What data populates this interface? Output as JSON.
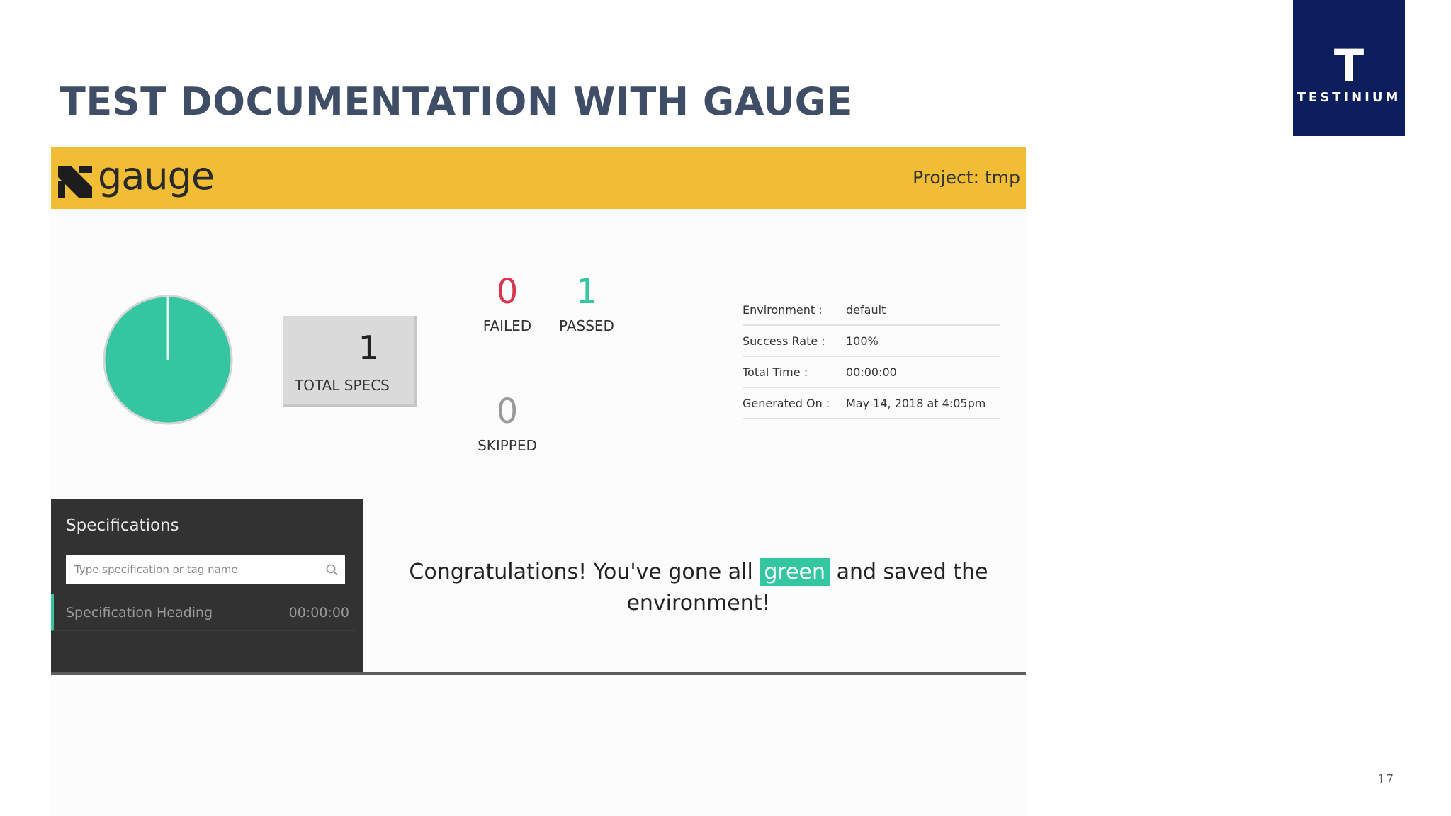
{
  "slide": {
    "title": "TEST DOCUMENTATION WITH GAUGE",
    "brand_letter": "T",
    "brand_name": "TESTINIUM",
    "page_number": "17",
    "colors": {
      "title": "#3f4e66",
      "brand_bg": "#0c1f5c"
    }
  },
  "report": {
    "logo_text": "gauge",
    "project": "Project: tmp",
    "pie": {
      "passed_fraction": 1.0,
      "color": "#34c6a1"
    },
    "total_specs": {
      "value": "1",
      "label": "TOTAL SPECS"
    },
    "stats": {
      "failed": {
        "value": "0",
        "label": "FAILED",
        "color": "#d9354e"
      },
      "passed": {
        "value": "1",
        "label": "PASSED",
        "color": "#34c6a1"
      },
      "skipped": {
        "value": "0",
        "label": "SKIPPED",
        "color": "#9a9a9a"
      }
    },
    "info": [
      {
        "key": "Environment :",
        "value": "default"
      },
      {
        "key": "Success Rate :",
        "value": "100%"
      },
      {
        "key": "Total Time :",
        "value": "00:00:00"
      },
      {
        "key": "Generated On :",
        "value": "May 14, 2018 at 4:05pm"
      }
    ],
    "specifications": {
      "title": "Specifications",
      "search_placeholder": "Type specification or tag name",
      "items": [
        {
          "name": "Specification Heading",
          "time": "00:00:00"
        }
      ]
    },
    "message": {
      "before": "Congratulations! You've gone all",
      "highlight": "green",
      "after": "and saved the environment!"
    },
    "colors": {
      "topbar": "#f1bd34",
      "panel": "#323232",
      "accent": "#34c6a1"
    }
  }
}
